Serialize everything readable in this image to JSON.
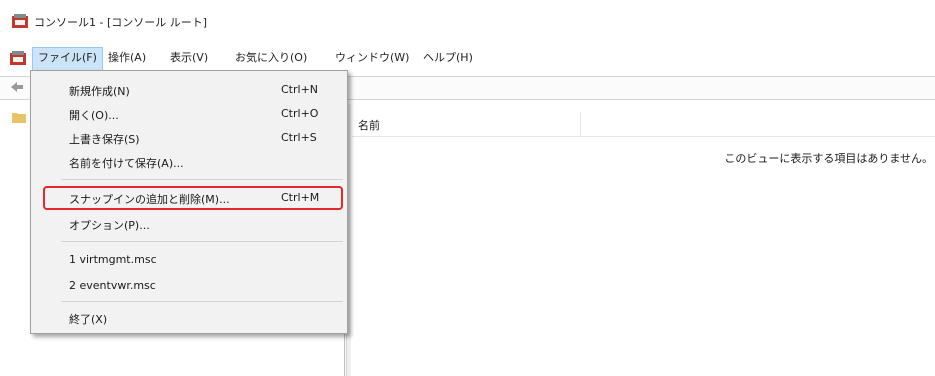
{
  "window": {
    "title": "コンソール1 - [コンソール ルート]"
  },
  "menubar": {
    "items": [
      {
        "label": "ファイル(F)"
      },
      {
        "label": "操作(A)"
      },
      {
        "label": "表示(V)"
      },
      {
        "label": "お気に入り(O)"
      },
      {
        "label": "ウィンドウ(W)"
      },
      {
        "label": "ヘルプ(H)"
      }
    ]
  },
  "file_menu": {
    "items": [
      {
        "label": "新規作成(N)",
        "shortcut": "Ctrl+N"
      },
      {
        "label": "開く(O)...",
        "shortcut": "Ctrl+O"
      },
      {
        "label": "上書き保存(S)",
        "shortcut": "Ctrl+S"
      },
      {
        "label": "名前を付けて保存(A)...",
        "shortcut": ""
      },
      {
        "label": "スナップインの追加と削除(M)...",
        "shortcut": "Ctrl+M"
      },
      {
        "label": "オプション(P)...",
        "shortcut": ""
      },
      {
        "label": "1 virtmgmt.msc",
        "shortcut": ""
      },
      {
        "label": "2 eventvwr.msc",
        "shortcut": ""
      },
      {
        "label": "終了(X)",
        "shortcut": ""
      }
    ]
  },
  "right_pane": {
    "column_name": "名前",
    "empty_message": "このビューに表示する項目はありません。"
  },
  "colors": {
    "highlight_ring": "#e4282c",
    "menu_active_bg": "#cce4f7",
    "menu_bg": "#f2f2f2"
  },
  "icons": [
    "mmc-app-icon",
    "back-arrow-icon",
    "folder-icon"
  ]
}
